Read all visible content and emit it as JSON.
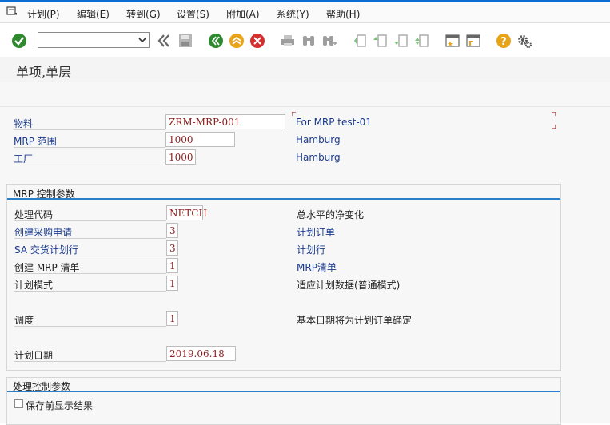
{
  "menu": {
    "items": [
      {
        "label": "计划(P)"
      },
      {
        "label": "编辑(E)"
      },
      {
        "label": "转到(G)"
      },
      {
        "label": "设置(S)"
      },
      {
        "label": "附加(A)"
      },
      {
        "label": "系统(Y)"
      },
      {
        "label": "帮助(H)"
      }
    ]
  },
  "toolbar": {
    "command_value": ""
  },
  "page": {
    "title": "单项,单层"
  },
  "header_fields": {
    "material": {
      "label": "物料",
      "value": "ZRM-MRP-001",
      "description": "For MRP test-01"
    },
    "mrp_area": {
      "label": "MRP 范围",
      "value": "1000",
      "description": "Hamburg"
    },
    "plant": {
      "label": "工厂",
      "value": "1000",
      "description": "Hamburg"
    }
  },
  "mrp_control": {
    "title": "MRP 控制参数",
    "processing_key": {
      "label": "处理代码",
      "value": "NETCH",
      "description": "总水平的净变化"
    },
    "create_pr": {
      "label": "创建采购申请",
      "value": "3",
      "description": "计划订单"
    },
    "sa_schedule": {
      "label": "SA 交货计划行",
      "value": "3",
      "description": "计划行"
    },
    "create_mrp_list": {
      "label": "创建 MRP 清单",
      "value": "1",
      "description": "MRP清单"
    },
    "planning_mode": {
      "label": "计划模式",
      "value": "1",
      "description": "适应计划数据(普通模式)"
    },
    "scheduling": {
      "label": "调度",
      "value": "1",
      "description": "基本日期将为计划订单确定"
    },
    "planning_date": {
      "label": "计划日期",
      "value": "2019.06.18"
    }
  },
  "process_control": {
    "title": "处理控制参数",
    "save_before_display": {
      "label": "保存前显示结果",
      "checked": false
    }
  },
  "colors": {
    "accent": "#0a6ed1",
    "label_blue": "#1a3a8c",
    "value_red": "#8b1a1a"
  }
}
